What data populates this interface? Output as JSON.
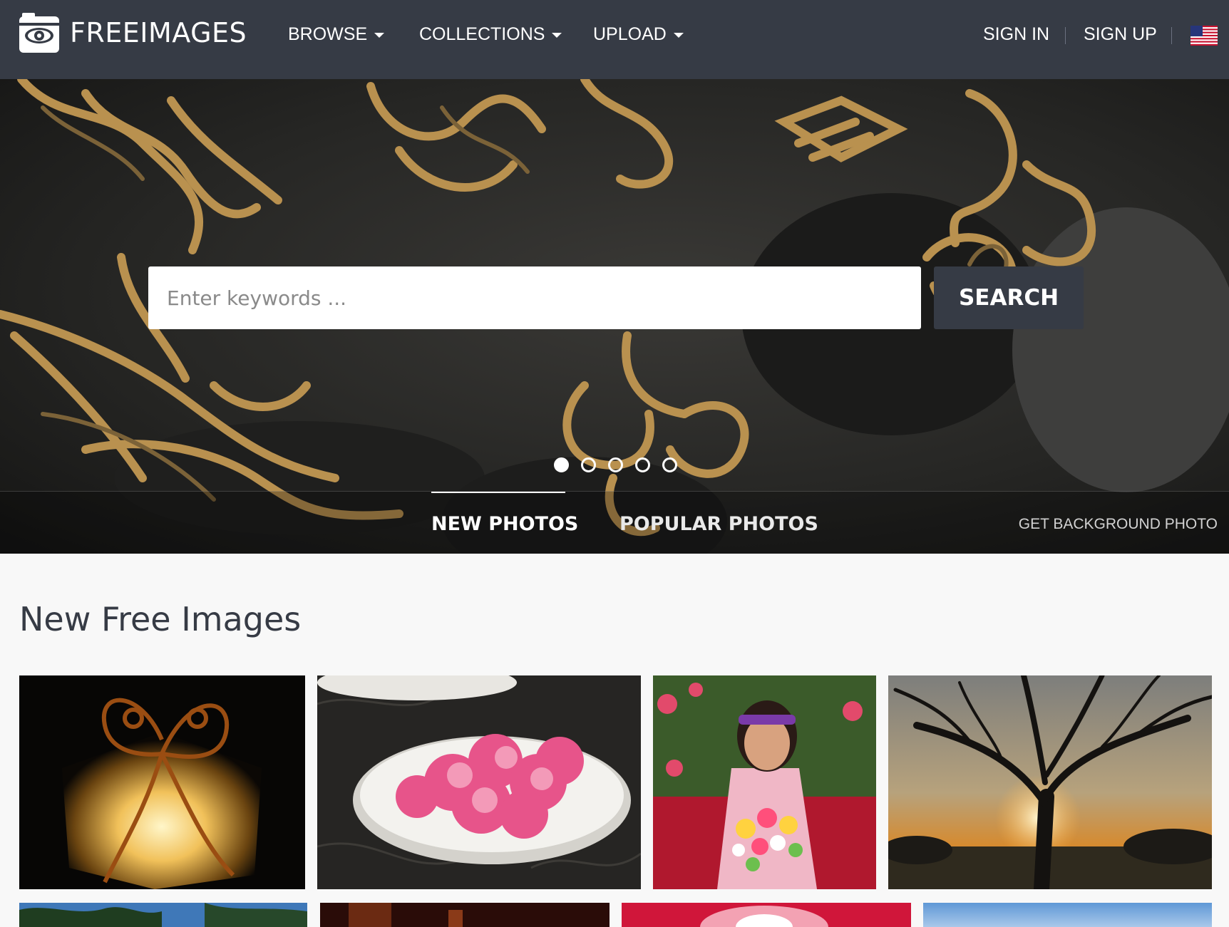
{
  "brand": {
    "name": "FREEIMAGES"
  },
  "nav": {
    "items": [
      {
        "label": "BROWSE"
      },
      {
        "label": "COLLECTIONS"
      },
      {
        "label": "UPLOAD"
      }
    ],
    "sign_in": "SIGN IN",
    "sign_up": "SIGN UP"
  },
  "search": {
    "placeholder": "Enter keywords ...",
    "button": "SEARCH"
  },
  "carousel": {
    "slides": 5,
    "active": 1
  },
  "tabs": {
    "new": "NEW PHOTOS",
    "popular": "POPULAR PHOTOS",
    "active": "NEW PHOTOS"
  },
  "get_background": "GET BACKGROUND PHOTO",
  "section": {
    "title": "New Free Images"
  },
  "colors": {
    "nav_bg": "#363b45",
    "page_bg": "#f8f8f8",
    "title": "#363b45"
  },
  "icons": [
    "camera-eye-logo-icon",
    "chevron-down-icon",
    "us-flag-icon"
  ]
}
